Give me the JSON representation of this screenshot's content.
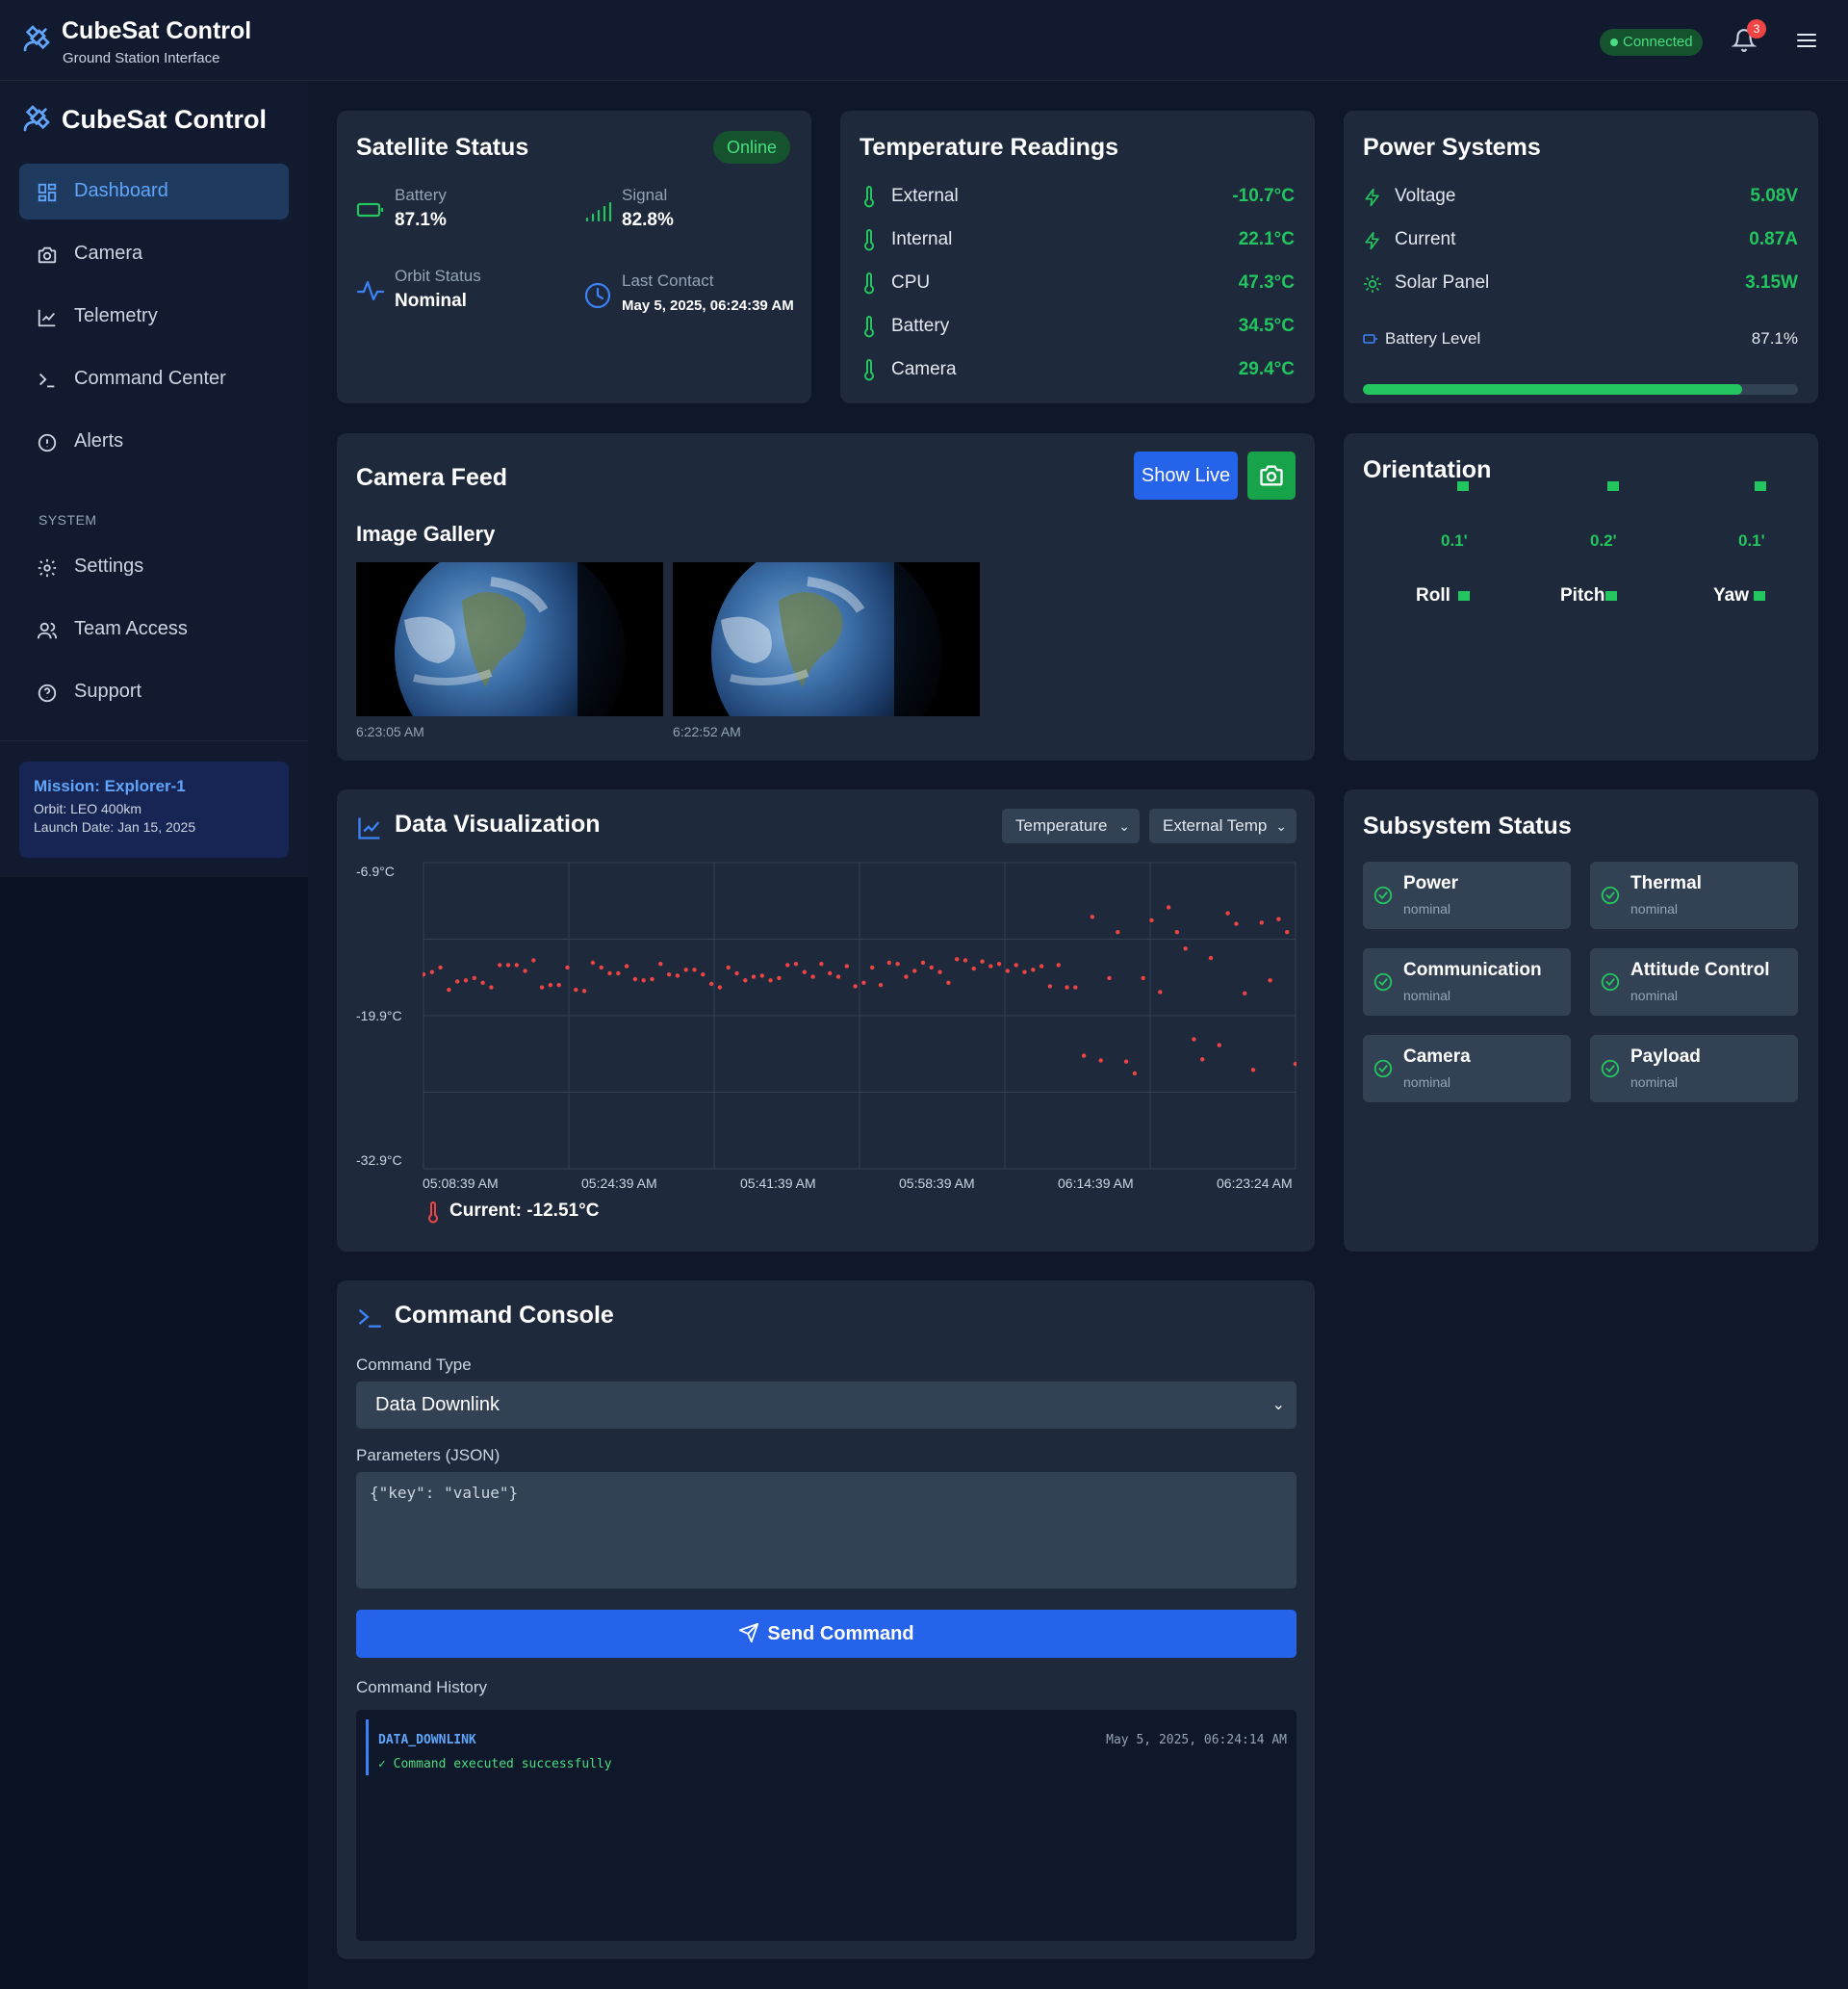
{
  "app": {
    "title": "CubeSat Control",
    "subtitle": "Ground Station Interface",
    "connection": "Connected",
    "notifications": "3"
  },
  "sidebar": {
    "title": "CubeSat Control",
    "items": [
      {
        "label": "Dashboard",
        "icon": "grid-icon",
        "active": true
      },
      {
        "label": "Camera",
        "icon": "camera-icon"
      },
      {
        "label": "Telemetry",
        "icon": "line-chart-icon"
      },
      {
        "label": "Command Center",
        "icon": "terminal-icon"
      },
      {
        "label": "Alerts",
        "icon": "alert-circle-icon"
      }
    ],
    "section_label": "SYSTEM",
    "system_items": [
      {
        "label": "Settings",
        "icon": "gear-icon"
      },
      {
        "label": "Team Access",
        "icon": "users-icon"
      },
      {
        "label": "Support",
        "icon": "help-circle-icon"
      }
    ],
    "mission": {
      "title": "Mission: Explorer-1",
      "orbit": "Orbit: LEO 400km",
      "launch": "Launch Date: Jan 15, 2025"
    }
  },
  "satellite_status": {
    "title": "Satellite Status",
    "badge": "Online",
    "battery_label": "Battery",
    "battery_value": "87.1%",
    "signal_label": "Signal",
    "signal_value": "82.8%",
    "orbit_label": "Orbit Status",
    "orbit_value": "Nominal",
    "contact_label": "Last Contact",
    "contact_value": "May 5, 2025, 06:24:39 AM"
  },
  "temperature": {
    "title": "Temperature Readings",
    "readings": [
      {
        "label": "External",
        "value": "-10.7°C"
      },
      {
        "label": "Internal",
        "value": "22.1°C"
      },
      {
        "label": "CPU",
        "value": "47.3°C"
      },
      {
        "label": "Battery",
        "value": "34.5°C"
      },
      {
        "label": "Camera",
        "value": "29.4°C"
      }
    ]
  },
  "power": {
    "title": "Power Systems",
    "readings": [
      {
        "label": "Voltage",
        "value": "5.08V",
        "icon": "lightning-icon"
      },
      {
        "label": "Current",
        "value": "0.87A",
        "icon": "lightning-icon"
      },
      {
        "label": "Solar Panel",
        "value": "3.15W",
        "icon": "sun-icon"
      }
    ],
    "battery_label": "Battery Level",
    "battery_value": "87.1%",
    "battery_fraction": 0.871
  },
  "camera": {
    "title": "Camera Feed",
    "show_live": "Show Live",
    "gallery_title": "Image Gallery",
    "images": [
      {
        "time": "6:23:05 AM"
      },
      {
        "time": "6:22:52 AM"
      }
    ]
  },
  "orientation": {
    "title": "Orientation",
    "axes": [
      {
        "name": "Roll",
        "value": "0.1'"
      },
      {
        "name": "Pitch",
        "value": "0.2'"
      },
      {
        "name": "Yaw",
        "value": "0.1'"
      }
    ]
  },
  "data_viz": {
    "title": "Data Visualization",
    "select_type": "Temperature",
    "select_sensor": "External Temp",
    "current": "Current: -12.51°C",
    "colors": {
      "points": "#ef4444",
      "grid": "#334155"
    }
  },
  "chart_data": {
    "type": "scatter",
    "title": "",
    "xlabel": "",
    "ylabel": "",
    "y_ticks": [
      "-6.9°C",
      "-19.9°C",
      "-32.9°C"
    ],
    "x_ticks": [
      "05:08:39 AM",
      "05:24:39 AM",
      "05:41:39 AM",
      "05:58:39 AM",
      "06:14:39 AM",
      "06:23:24 AM"
    ],
    "ylim": [
      -32.9,
      -6.9
    ],
    "grid": true,
    "series": [
      {
        "values": [
          -16.4,
          -16.2,
          -15.8,
          -17.7,
          -17.0,
          -16.9,
          -16.7,
          -17.1,
          -17.5,
          -15.6,
          -15.6,
          -15.6,
          -16.1,
          -15.2,
          -17.5,
          -17.3,
          -17.3,
          -15.8,
          -17.7,
          -17.8,
          -15.4,
          -15.8,
          -16.3,
          -16.3,
          -15.7,
          -16.8,
          -16.9,
          -16.8,
          -15.5,
          -16.4,
          -16.5,
          -16.0,
          -16.0,
          -16.4,
          -17.2,
          -17.5,
          -15.8,
          -16.3,
          -16.9,
          -16.6,
          -16.5,
          -16.9,
          -16.7,
          -15.6,
          -15.5,
          -16.2,
          -16.6,
          -15.5,
          -16.3,
          -16.6,
          -15.7,
          -17.4,
          -17.1,
          -15.8,
          -17.3,
          -15.4,
          -15.5,
          -16.6,
          -16.1,
          -15.4,
          -15.8,
          -16.2,
          -17.1,
          -15.1,
          -15.2,
          -15.9,
          -15.3,
          -15.7,
          -15.5,
          -16.1,
          -15.6,
          -16.2,
          -16.0,
          -15.7,
          -17.4,
          -15.6,
          -17.5,
          -17.5,
          -23.3,
          -11.5,
          -23.7,
          -16.7,
          -12.8,
          -23.8,
          -24.8,
          -16.7,
          -11.8,
          -17.9,
          -10.7,
          -12.8,
          -14.2,
          -21.9,
          -23.6,
          -15.0,
          -22.4,
          -11.2,
          -12.1,
          -18.0,
          -24.5,
          -12.0,
          -16.9,
          -11.7,
          -12.8,
          -24.0
        ]
      }
    ]
  },
  "subsystems": {
    "title": "Subsystem Status",
    "items": [
      {
        "name": "Power",
        "state": "nominal"
      },
      {
        "name": "Thermal",
        "state": "nominal"
      },
      {
        "name": "Communication",
        "state": "nominal"
      },
      {
        "name": "Attitude Control",
        "state": "nominal"
      },
      {
        "name": "Camera",
        "state": "nominal"
      },
      {
        "name": "Payload",
        "state": "nominal"
      }
    ]
  },
  "console": {
    "title": "Command Console",
    "type_label": "Command Type",
    "type_value": "Data Downlink",
    "params_label": "Parameters (JSON)",
    "params_placeholder": "{\"key\": \"value\"}",
    "send_label": "Send Command",
    "history_label": "Command History",
    "history": [
      {
        "command": "DATA_DOWNLINK",
        "time": "May 5, 2025, 06:24:14 AM",
        "result": "✓ Command executed successfully"
      }
    ]
  }
}
